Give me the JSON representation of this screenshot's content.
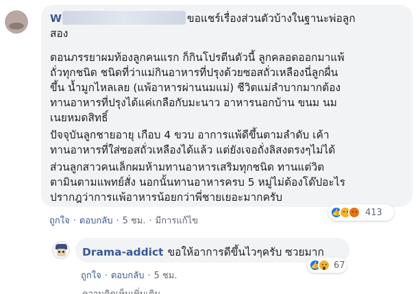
{
  "main_comment": {
    "author_visible": "W",
    "author_obscured": true,
    "lines": [
      "ขอแชร์เรื่องส่วนตัวบ้างในฐานะพ่อลูก",
      "สอง",
      "ตอนภรรยาผมท้องลูกคนแรก ก็กินโปรตีนตัวนี้ ลูกคลอดออกมาแพ้",
      "ถั่วทุกชนิด ชนิดที่ว่าแม่กินอาหารที่ปรุงด้วยซอสถั่วเหลืองนี่ลูกผื่น",
      "ขึ้น น้ำมูกไหลเลย (แพ้อาหารผ่านนมแม่) ชีวิตแม่ลำบากมากต้อง",
      "ทานอาหารที่ปรุงได้แค่เกลือกับมะนาว อาหารนอกบ้าน ขนม นม",
      "เนยหมดสิทธิ์",
      "ปัจจุบันลูกชายอายุ เกือบ 4 ขวบ อาการแพ้ดีขึ้นตามลำดับ เค้า",
      "ทานอาหารที่ใส่ซอสถั่วเหลืองได้แล้ว แต่ยังเจอถั่งลิสงตรงๆไม่ได้",
      "ส่วนลูกสาวคนเล็กผมห้ามทานอาหารเสริมทุกชนิด ทานแต่วิต",
      "ตามินตามแพทย์สั่ง นอกนั้นทานอาหารครบ 5 หมู่ไม่ต้องโด๊ปอะไร",
      "ปรากฎว่าการแพ้อาหารน้อยกว่าพี่ชายเยอะมากครับ"
    ],
    "reaction_count": "413",
    "reaction_icons": [
      "like-icon",
      "sad-icon",
      "angry-icon"
    ],
    "actions": {
      "like": "ถูกใจ",
      "reply": "ตอบกลับ",
      "time": "5 ชม.",
      "edited": "มีการแก้ไข"
    }
  },
  "reply_comment": {
    "author": "Drama-addict",
    "text": "ขอให้อาการดีขึ้นไวๆครับ ซวยมาก",
    "reaction_count": "67",
    "reaction_icons": [
      "like-icon",
      "wow-icon"
    ],
    "actions": {
      "like": "ถูกใจ",
      "reply": "ตอบกลับ",
      "time": "5 ชม."
    }
  },
  "footer_partial": "ความคิดเห็นเพิ่มเติม",
  "colors": {
    "link": "#385898",
    "bubble": "#f2f3f5",
    "meta": "#606770",
    "like": "#1877f2"
  }
}
